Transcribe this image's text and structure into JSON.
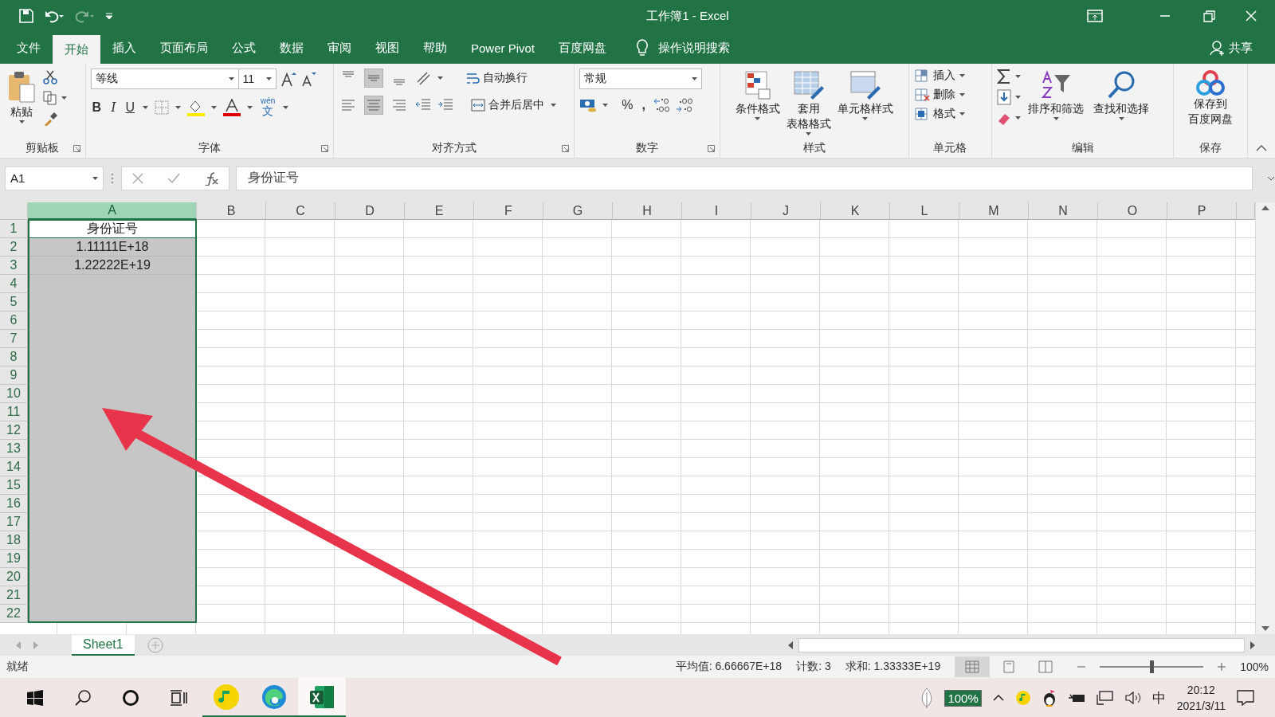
{
  "window": {
    "title": "工作簿1 - Excel"
  },
  "menu_tabs": [
    {
      "label": "文件",
      "selected": false
    },
    {
      "label": "开始",
      "selected": true
    },
    {
      "label": "插入",
      "selected": false
    },
    {
      "label": "页面布局",
      "selected": false
    },
    {
      "label": "公式",
      "selected": false
    },
    {
      "label": "数据",
      "selected": false
    },
    {
      "label": "审阅",
      "selected": false
    },
    {
      "label": "视图",
      "selected": false
    },
    {
      "label": "帮助",
      "selected": false
    },
    {
      "label": "Power Pivot",
      "selected": false
    },
    {
      "label": "百度网盘",
      "selected": false
    }
  ],
  "tell_me": {
    "placeholder": "操作说明搜索"
  },
  "share": "共享",
  "ribbon": {
    "clipboard": {
      "paste": "粘贴",
      "label": "剪贴板"
    },
    "font": {
      "name": "等线",
      "size": "11",
      "bold": "B",
      "italic": "I",
      "underline": "U",
      "phonetic_top": "wén",
      "phonetic": "文",
      "label": "字体"
    },
    "alignment": {
      "wrap": "自动换行",
      "merge": "合并后居中",
      "label": "对齐方式"
    },
    "number": {
      "format": "常规",
      "percent": "%",
      "comma": ",",
      "label": "数字"
    },
    "styles": {
      "buttons": [
        [
          "条件格式"
        ],
        [
          "套用",
          "表格格式"
        ],
        [
          "单元格样式"
        ]
      ],
      "label": "样式"
    },
    "cells": {
      "buttons": [
        "插入",
        "删除",
        "格式"
      ],
      "label": "单元格"
    },
    "editing": {
      "buttons": [
        "排序和筛选",
        "查找和选择"
      ],
      "label": "编辑"
    },
    "save": {
      "button": [
        "保存到",
        "百度网盘"
      ],
      "label": "保存"
    }
  },
  "name_box": "A1",
  "formula": "身份证号",
  "columns": [
    {
      "label": "A",
      "selected": true
    },
    {
      "label": "B",
      "selected": false
    },
    {
      "label": "C",
      "selected": false
    },
    {
      "label": "D",
      "selected": false
    },
    {
      "label": "E",
      "selected": false
    },
    {
      "label": "F",
      "selected": false
    },
    {
      "label": "G",
      "selected": false
    },
    {
      "label": "H",
      "selected": false
    },
    {
      "label": "I",
      "selected": false
    },
    {
      "label": "J",
      "selected": false
    },
    {
      "label": "K",
      "selected": false
    },
    {
      "label": "L",
      "selected": false
    },
    {
      "label": "M",
      "selected": false
    },
    {
      "label": "N",
      "selected": false
    },
    {
      "label": "O",
      "selected": false
    },
    {
      "label": "P",
      "selected": false
    }
  ],
  "rows": [
    {
      "label": "1",
      "cells": [
        "身份证号"
      ]
    },
    {
      "label": "2",
      "cells": [
        "1.11111E+18"
      ]
    },
    {
      "label": "3",
      "cells": [
        "1.22222E+19"
      ]
    },
    {
      "label": "4"
    },
    {
      "label": "5"
    },
    {
      "label": "6"
    },
    {
      "label": "7"
    },
    {
      "label": "8"
    },
    {
      "label": "9"
    },
    {
      "label": "10"
    },
    {
      "label": "11"
    },
    {
      "label": "12"
    },
    {
      "label": "13"
    },
    {
      "label": "14"
    },
    {
      "label": "15"
    },
    {
      "label": "16"
    },
    {
      "label": "17"
    },
    {
      "label": "18"
    },
    {
      "label": "19"
    },
    {
      "label": "20"
    },
    {
      "label": "21"
    },
    {
      "label": "22"
    }
  ],
  "sheet_tabs": [
    {
      "label": "Sheet1",
      "selected": true
    }
  ],
  "status_bar": {
    "ready": "就绪",
    "average": "平均值: 6.66667E+18",
    "count": "计数: 3",
    "sum": "求和: 1.33333E+19",
    "zoom": "100%",
    "zoom_slider": {
      "level": 0.5
    }
  },
  "taskbar": {
    "apps": [
      {
        "kind": "music",
        "selected": false
      },
      {
        "kind": "browser",
        "selected": false
      },
      {
        "kind": "spreadsheet",
        "selected": true
      }
    ],
    "battery": "100%",
    "ime": "中",
    "time": "20:12",
    "date": "2021/3/11"
  }
}
